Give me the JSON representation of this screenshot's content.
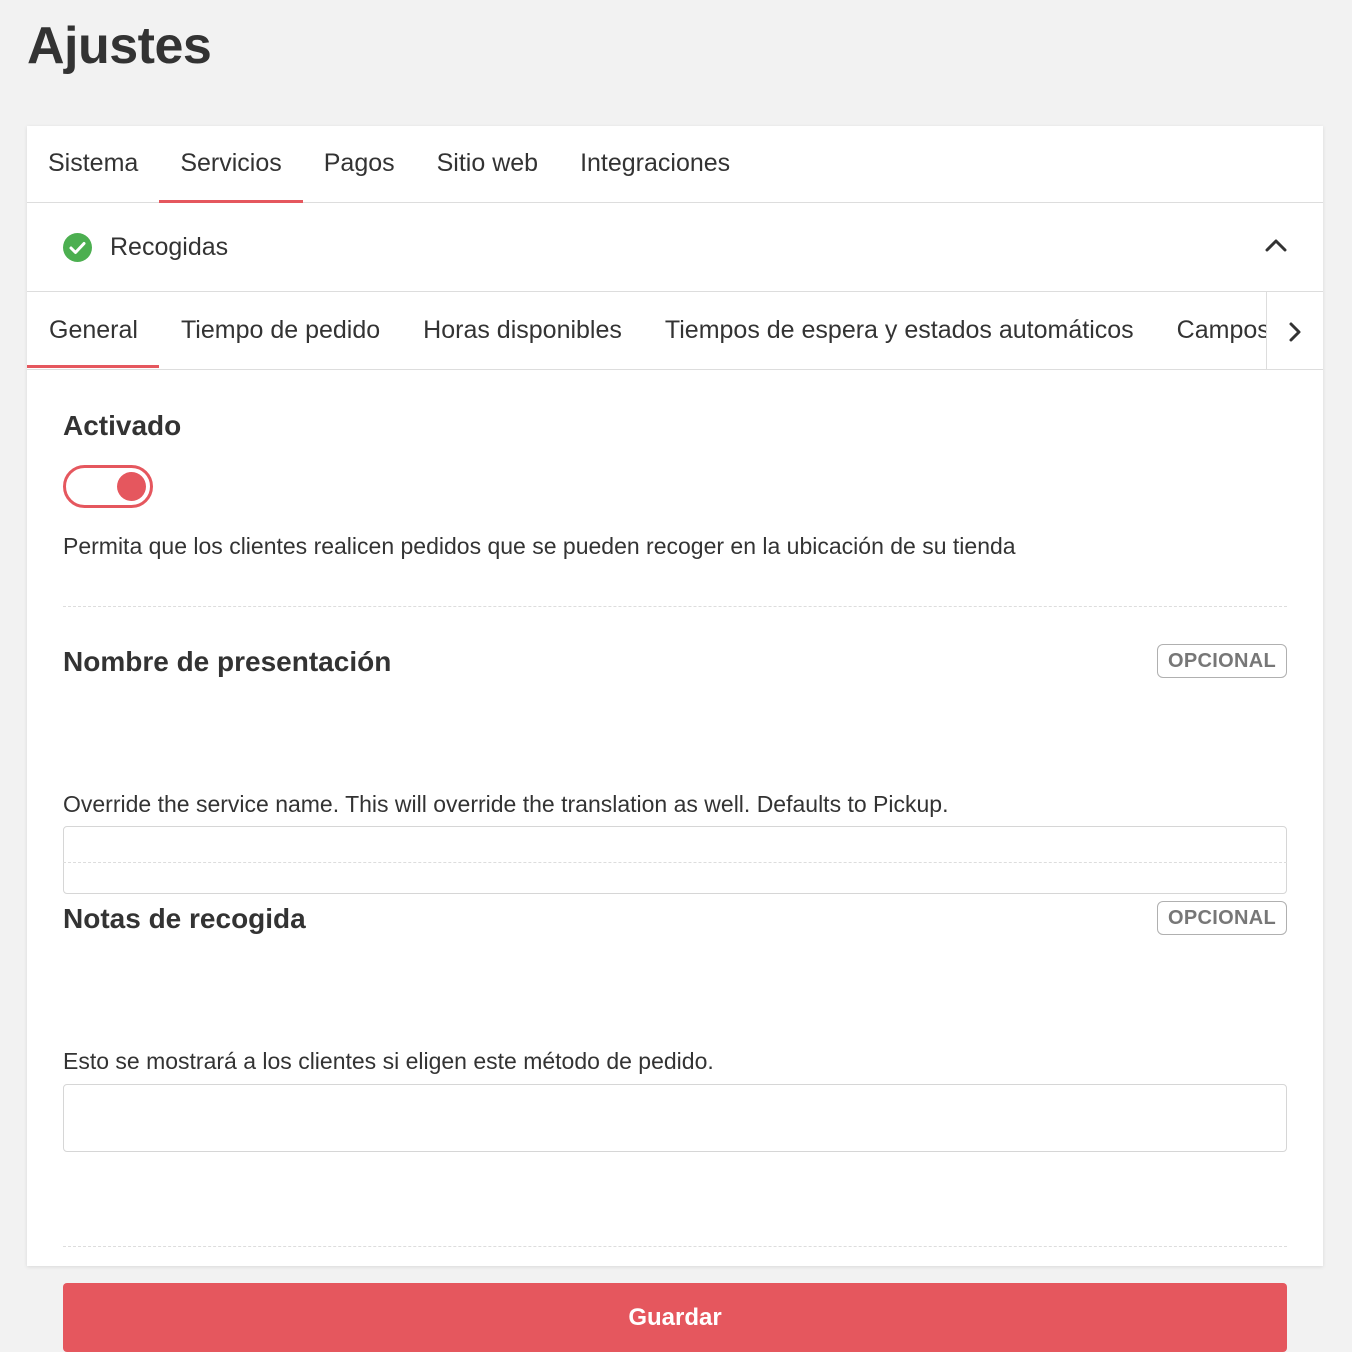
{
  "page": {
    "title": "Ajustes"
  },
  "colors": {
    "accent": "#e5575e",
    "success": "#4caf50"
  },
  "top_tabs": [
    {
      "label": "Sistema",
      "active": false
    },
    {
      "label": "Servicios",
      "active": true
    },
    {
      "label": "Pagos",
      "active": false
    },
    {
      "label": "Sitio web",
      "active": false
    },
    {
      "label": "Integraciones",
      "active": false
    }
  ],
  "section": {
    "title": "Recogidas",
    "status_icon": "check-circle-icon",
    "collapse_icon": "chevron-up-icon",
    "expanded": true
  },
  "sub_tabs": [
    {
      "label": "General",
      "active": true
    },
    {
      "label": "Tiempo de pedido",
      "active": false
    },
    {
      "label": "Horas disponibles",
      "active": false
    },
    {
      "label": "Tiempos de espera y estados automáticos",
      "active": false
    },
    {
      "label": "Campos de",
      "active": false
    }
  ],
  "sub_tabs_scroll_icon": "chevron-right-icon",
  "form": {
    "enabled": {
      "label": "Activado",
      "value": true,
      "help": "Permita que los clientes realicen pedidos que se pueden recoger en la ubicación de su tienda"
    },
    "display_name": {
      "label": "Nombre de presentación",
      "badge": "OPCIONAL",
      "value": "",
      "help": "Override the service name. This will override the translation as well. Defaults to Pickup."
    },
    "pickup_notes": {
      "label": "Notas de recogida",
      "badge": "OPCIONAL",
      "value": "",
      "help": "Esto se mostrará a los clientes si eligen este método de pedido."
    },
    "save_label": "Guardar"
  }
}
